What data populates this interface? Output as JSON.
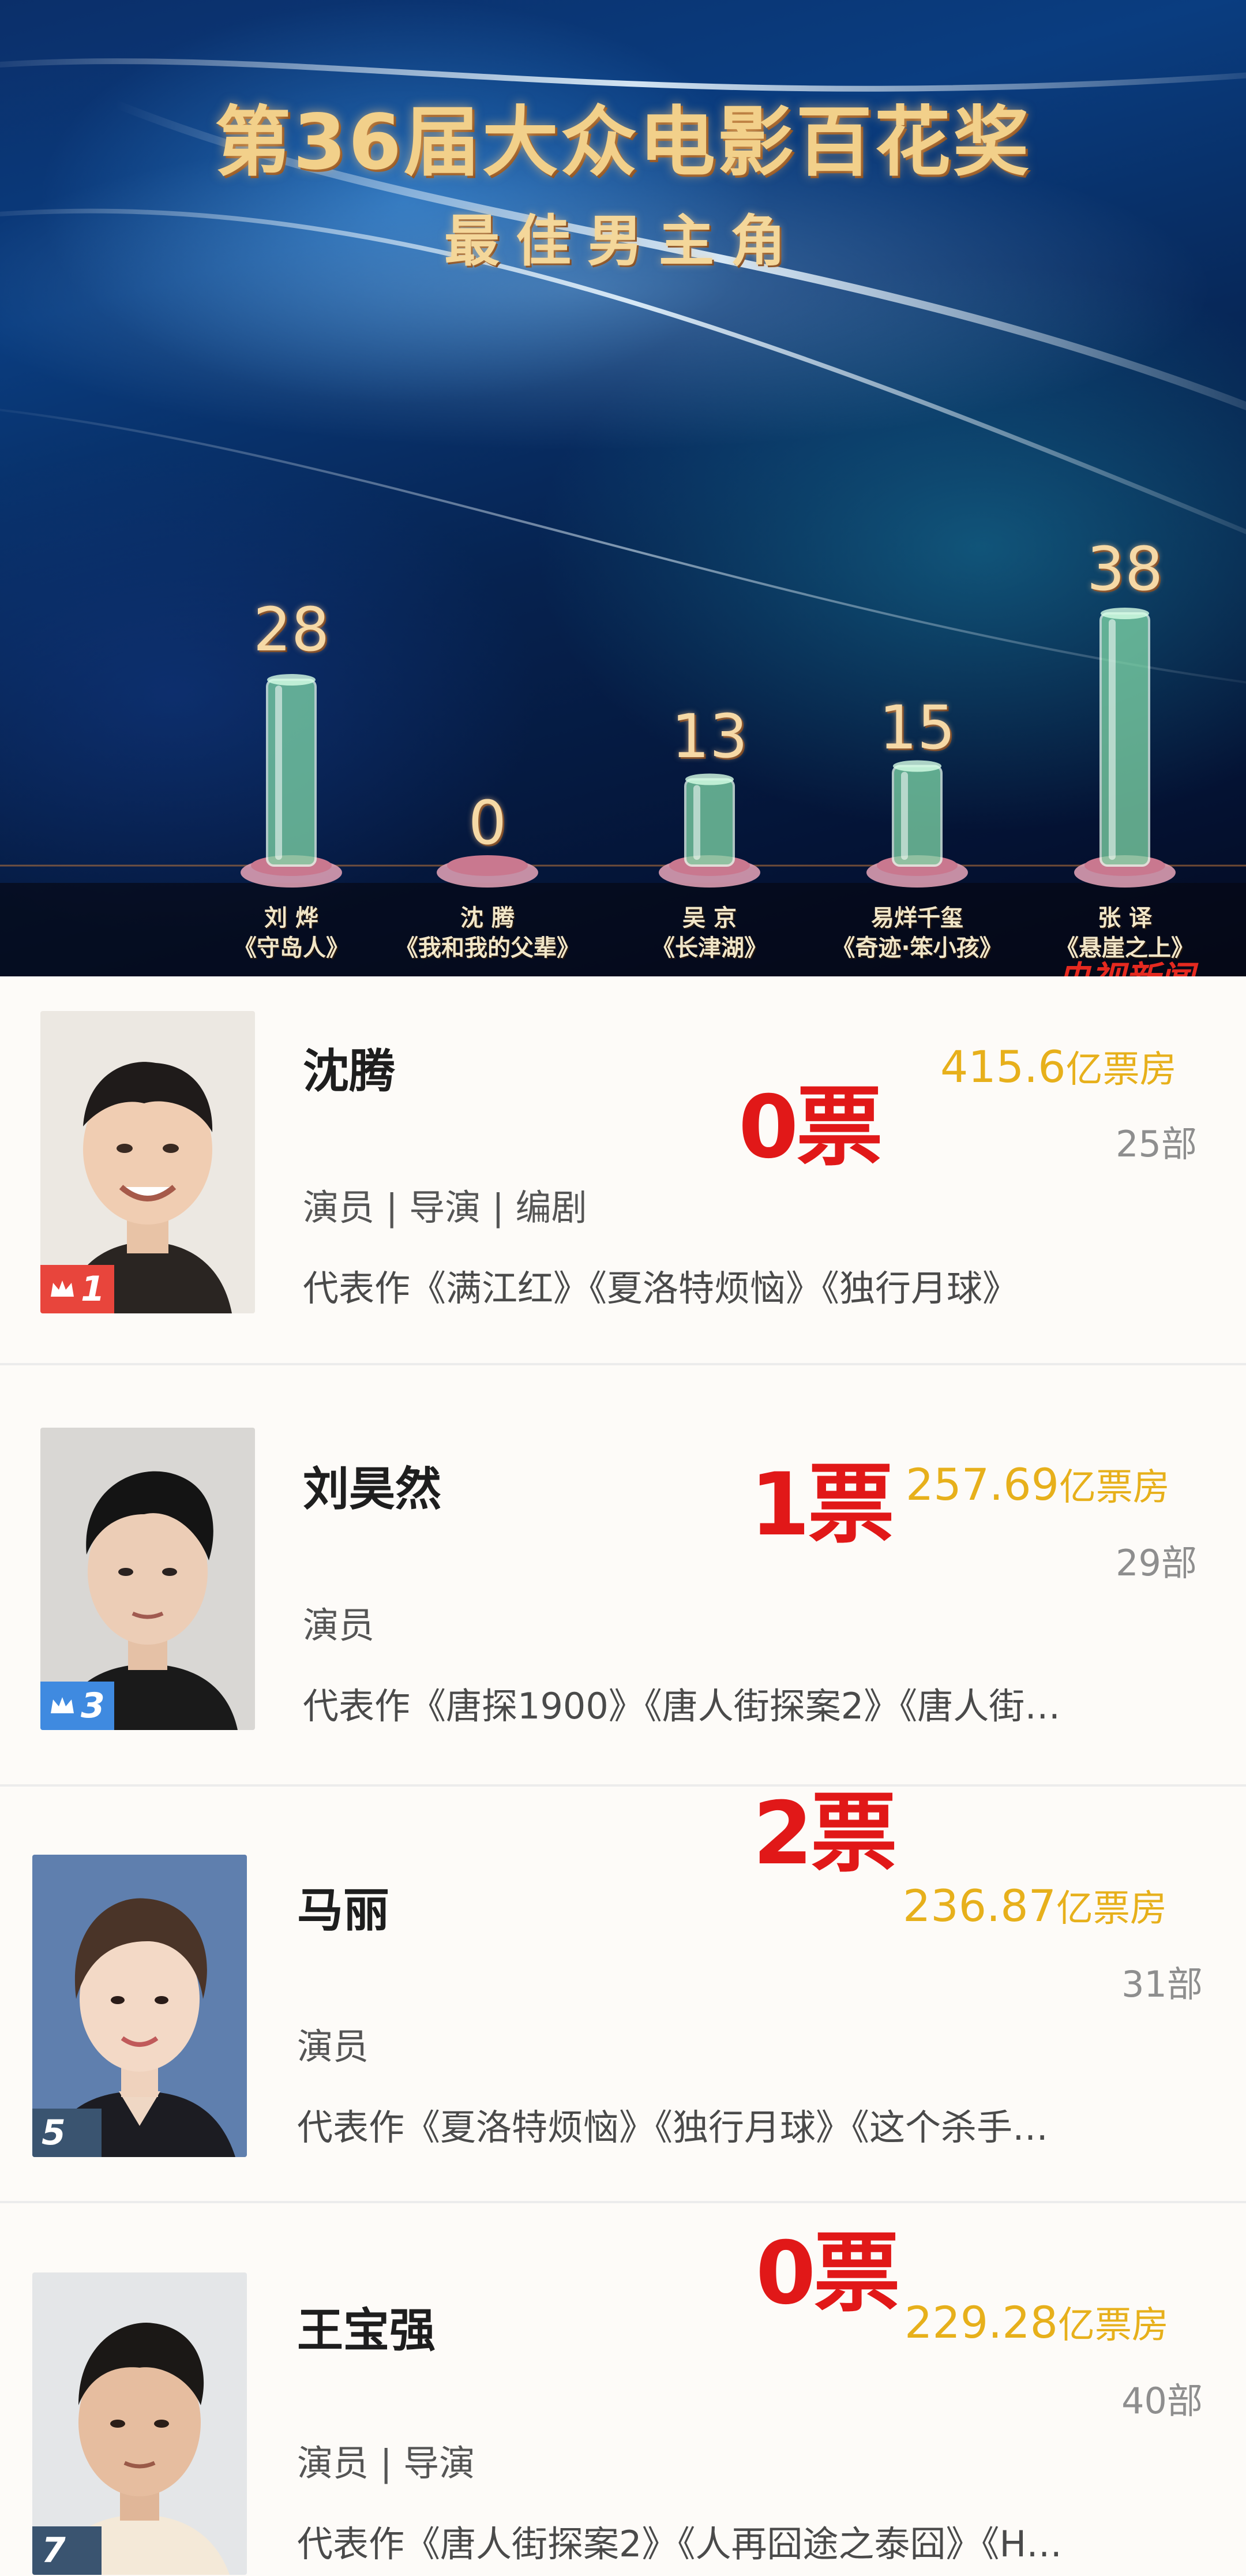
{
  "broadcast": {
    "title": "第36届大众电影百花奖",
    "subtitle": "最佳男主角",
    "logo_text": "央视新闻",
    "chart_data": {
      "type": "bar",
      "title": "第36届大众电影百花奖",
      "subtitle": "最佳男主角",
      "categories": [
        "刘烨《守岛人》",
        "沈腾《我和我的父辈》",
        "吴京《长津湖》",
        "易烊千玺《奇迹·笨小孩》",
        "张译《悬崖之上》"
      ],
      "values": [
        28,
        0,
        13,
        15,
        38
      ],
      "ylim": [
        0,
        40
      ],
      "grid": false,
      "legend": "none"
    },
    "nominees": [
      {
        "name": "刘 烨",
        "film": "《守岛人》",
        "votes": "28"
      },
      {
        "name": "沈 腾",
        "film": "《我和我的父辈》",
        "votes": "0"
      },
      {
        "name": "吴 京",
        "film": "《长津湖》",
        "votes": "13"
      },
      {
        "name": "易烊千玺",
        "film": "《奇迹·笨小孩》",
        "votes": "15"
      },
      {
        "name": "张 译",
        "film": "《悬崖之上》",
        "votes": "38"
      }
    ],
    "colors": {
      "bar_glass": "#7fd8a8",
      "title_gold": "#f2d08a",
      "ring_pink": "#e8a4b8"
    }
  },
  "actors": [
    {
      "name": "沈腾",
      "roles": "演员 | 导演 | 编剧",
      "works": "代表作《满江红》《夏洛特烦恼》《独行月球》",
      "votes": "0票",
      "box_office_value": "415.6",
      "box_office_unit": "亿票房",
      "film_count": "25部",
      "rank": "1",
      "rank_icon": "crown-icon",
      "badge_color": "#e8453c"
    },
    {
      "name": "刘昊然",
      "roles": "演员",
      "works": "代表作《唐探1900》《唐人街探案2》《唐人街…",
      "votes": "1票",
      "box_office_value": "257.69",
      "box_office_unit": "亿票房",
      "film_count": "29部",
      "rank": "3",
      "rank_icon": "crown-icon",
      "badge_color": "#3f8ae0"
    },
    {
      "name": "马丽",
      "roles": "演员",
      "works": "代表作《夏洛特烦恼》《独行月球》《这个杀手…",
      "votes": "2票",
      "box_office_value": "236.87",
      "box_office_unit": "亿票房",
      "film_count": "31部",
      "rank": "5",
      "rank_icon": "",
      "badge_color": "#3a5470"
    },
    {
      "name": "王宝强",
      "roles": "演员 | 导演",
      "works": "代表作《唐人街探案2》《人再囧途之泰囧》《H…",
      "votes": "0票",
      "box_office_value": "229.28",
      "box_office_unit": "亿票房",
      "film_count": "40部",
      "rank": "7",
      "rank_icon": "",
      "badge_color": "#3a5470"
    }
  ]
}
